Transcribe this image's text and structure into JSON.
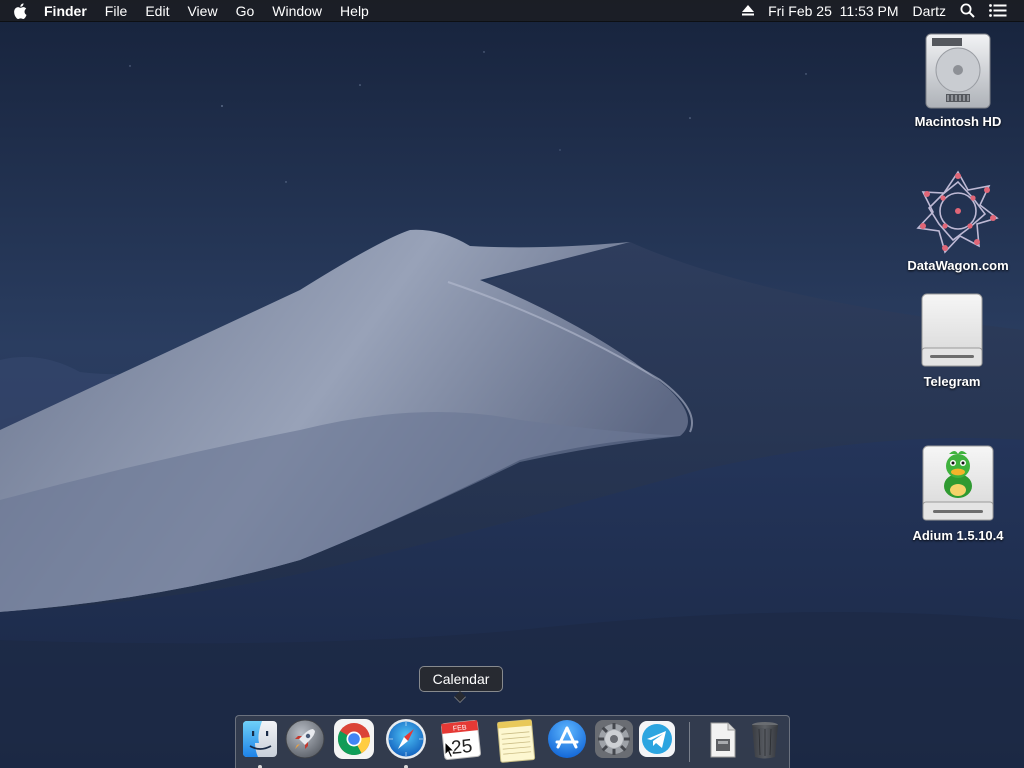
{
  "menubar": {
    "apple_icon": "apple-logo-icon",
    "app_name": "Finder",
    "menus": [
      "File",
      "Edit",
      "View",
      "Go",
      "Window",
      "Help"
    ],
    "status": {
      "eject_icon": "eject-icon",
      "clock": "Fri Feb 25  11:53 PM",
      "user": "Dartz",
      "spotlight_icon": "spotlight-search-icon",
      "notification_icon": "notification-center-icon"
    }
  },
  "desktop": {
    "icons": [
      {
        "label": "Macintosh HD",
        "icon": "hard-drive-icon"
      },
      {
        "label": "DataWagon.com",
        "icon": "datawagon-logo-icon"
      },
      {
        "label": "Telegram",
        "icon": "disk-image-icon"
      },
      {
        "label": "Adium 1.5.10.4",
        "icon": "adium-duck-icon"
      }
    ]
  },
  "dock": {
    "tooltip": "Calendar",
    "calendar": {
      "month": "FEB",
      "day": "25"
    },
    "items": [
      {
        "name": "Finder",
        "icon": "finder-icon",
        "running": true
      },
      {
        "name": "Launchpad",
        "icon": "launchpad-rocket-icon",
        "running": false
      },
      {
        "name": "Google Chrome",
        "icon": "chrome-icon",
        "running": false
      },
      {
        "name": "Safari",
        "icon": "safari-compass-icon",
        "running": true
      },
      {
        "name": "Calendar",
        "icon": "calendar-icon",
        "running": false
      },
      {
        "name": "Notes",
        "icon": "notes-icon",
        "running": false
      },
      {
        "name": "App Store",
        "icon": "app-store-icon",
        "running": false
      },
      {
        "name": "System Preferences",
        "icon": "gear-icon",
        "running": false
      },
      {
        "name": "Telegram",
        "icon": "telegram-plane-icon",
        "running": false
      },
      {
        "name": "Downloads",
        "icon": "document-icon",
        "running": false
      },
      {
        "name": "Trash",
        "icon": "trash-icon",
        "running": false
      }
    ]
  },
  "colors": {
    "menubar_bg": "#1c1e24",
    "sky_top": "#1b2a47",
    "sky_bottom": "#2f4466",
    "dune": "#7f8aa3"
  }
}
